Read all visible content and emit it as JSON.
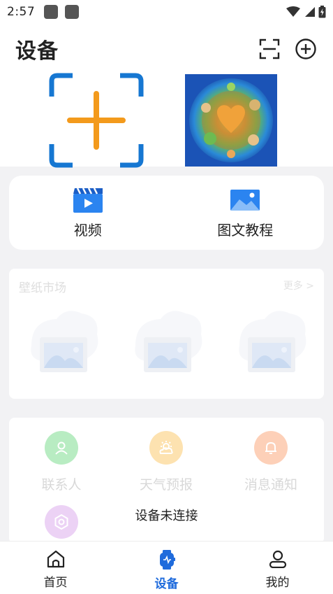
{
  "status_bar": {
    "time": "2:57"
  },
  "header": {
    "title": "设备"
  },
  "tutorials": [
    {
      "label": "视频",
      "icon": "video-icon"
    },
    {
      "label": "图文教程",
      "icon": "image-icon"
    }
  ],
  "wallpaper_market": {
    "title": "壁纸市场",
    "more": "更多 >"
  },
  "functions": [
    {
      "label": "联系人",
      "icon": "contact-icon",
      "color": "#b8ecc2"
    },
    {
      "label": "天气预报",
      "icon": "weather-icon",
      "color": "#fde2b0"
    },
    {
      "label": "消息通知",
      "icon": "bell-icon",
      "color": "#fdd0b8"
    },
    {
      "label": "",
      "icon": "settings-icon",
      "color": "#ecd2f5"
    }
  ],
  "toast": "设备未连接",
  "bottom_nav": [
    {
      "label": "首页",
      "icon": "home-icon"
    },
    {
      "label": "设备",
      "icon": "watch-icon",
      "active": true
    },
    {
      "label": "我的",
      "icon": "profile-icon"
    }
  ],
  "colors": {
    "accent": "#1f6bdc",
    "add_frame": "#1677d2",
    "add_plus": "#f39a1c"
  }
}
